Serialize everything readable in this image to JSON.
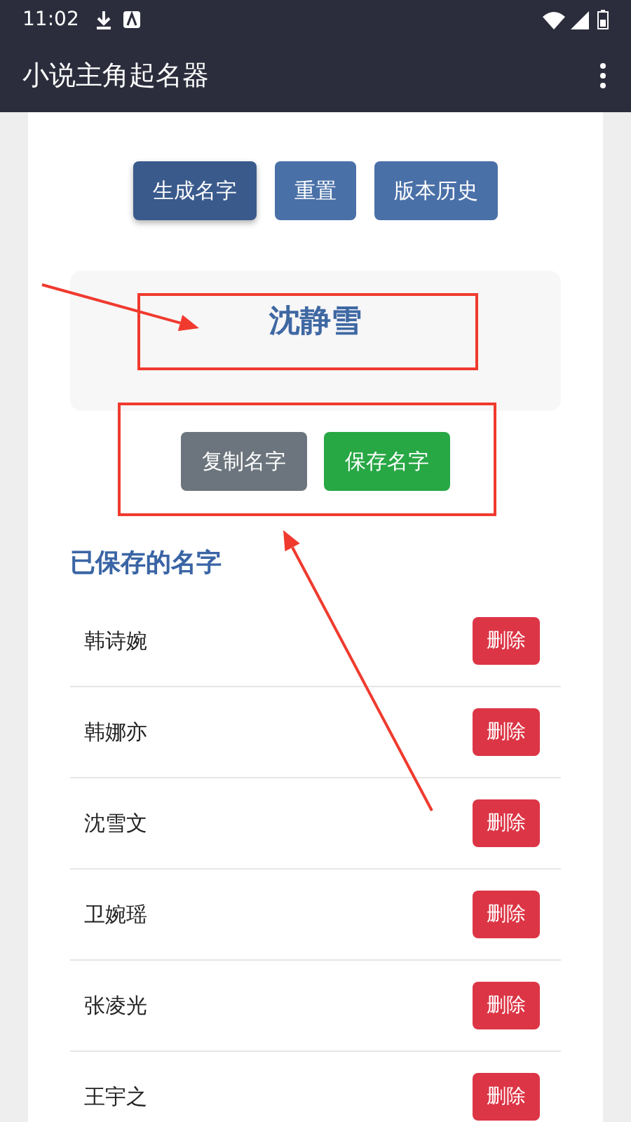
{
  "status_bar": {
    "time": "11:02"
  },
  "app_bar": {
    "title": "小说主角起名器"
  },
  "buttons": [
    {
      "label": "生成名字",
      "selected": true
    },
    {
      "label": "重置",
      "selected": false
    },
    {
      "label": "版本历史",
      "selected": false
    }
  ],
  "generated_name": "沈静雪",
  "actions": [
    {
      "label": "复制名字",
      "kind": "secondary"
    },
    {
      "label": "保存名字",
      "kind": "success"
    }
  ],
  "saved": {
    "heading": "已保存的名字",
    "items": [
      {
        "name": "韩诗婉",
        "action": "删除"
      },
      {
        "name": "韩娜亦",
        "action": "删除"
      },
      {
        "name": "沈雪文",
        "action": "删除"
      },
      {
        "name": "卫婉瑶",
        "action": "删除"
      },
      {
        "name": "张凌光",
        "action": "删除"
      },
      {
        "name": "王宇之",
        "action": "删除"
      }
    ]
  }
}
